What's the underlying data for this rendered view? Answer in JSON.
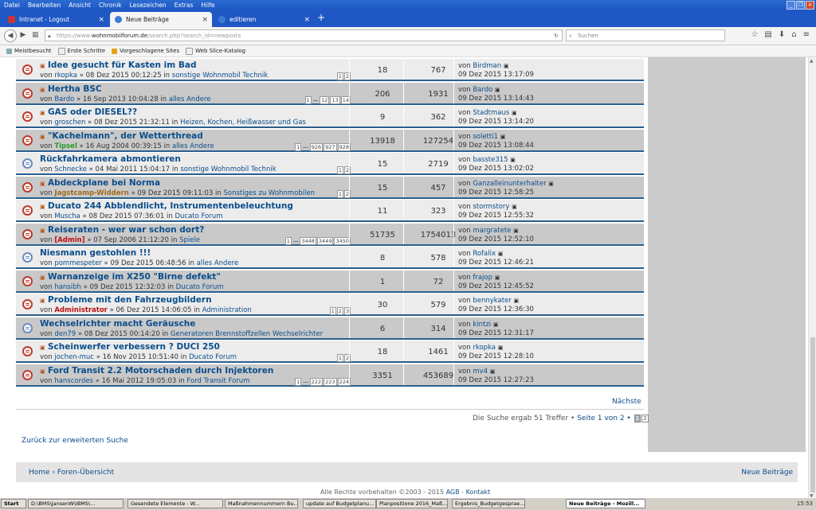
{
  "menu": [
    "Datei",
    "Bearbeiten",
    "Ansicht",
    "Chronik",
    "Lesezeichen",
    "Extras",
    "Hilfe"
  ],
  "tabs": [
    {
      "label": "Intranet - Logout",
      "active": false
    },
    {
      "label": "Neue Beiträge",
      "active": true
    },
    {
      "label": "editieren",
      "active": false
    }
  ],
  "url": {
    "prefix": "https://www.",
    "host": "wohnmobilforum.de",
    "path": "/search.php?search_id=newposts"
  },
  "search_placeholder": "Suchen",
  "bookmarks": [
    "Meistbesucht",
    "Erste Schritte",
    "Vorgeschlagene Sites",
    "Web Slice-Katalog"
  ],
  "topics": [
    {
      "title": "Idee gesucht für Kasten im Bad",
      "author": "rkopka",
      "date": "08 Dez 2015 00:12:25",
      "forum": "sonstige Wohnmobil Technik",
      "pages": [
        "1",
        "2"
      ],
      "replies": "18",
      "views": "767",
      "last_by": "Birdman",
      "last_date": "09 Dez 2015 13:17:09",
      "new": true
    },
    {
      "title": "Hertha BSC",
      "author": "Bardo",
      "date": "16 Sep 2013 10:04:28",
      "forum": "alles Andere",
      "pages": [
        "1",
        "…",
        "12",
        "13",
        "14"
      ],
      "replies": "206",
      "views": "1931",
      "last_by": "Bardo",
      "last_date": "09 Dez 2015 13:14:43",
      "new": true
    },
    {
      "title": "GAS oder DIESEL??",
      "author": "groschen",
      "date": "08 Dez 2015 21:32:11",
      "forum": "Heizen, Kochen, Heißwasser und Gas",
      "pages": [],
      "replies": "9",
      "views": "362",
      "last_by": "Stadtmaus",
      "last_date": "09 Dez 2015 13:14:20",
      "new": true
    },
    {
      "title": "\"Kachelmann\", der Wetterthread",
      "author": "Tipsel",
      "author_style": "green",
      "date": "16 Aug 2004 00:39:15",
      "forum": "alles Andere",
      "pages": [
        "1",
        "…",
        "926",
        "927",
        "928"
      ],
      "replies": "13918",
      "views": "127254",
      "last_by": "soletti1",
      "last_date": "09 Dez 2015 13:08:44",
      "new": true
    },
    {
      "title": "Rückfahrkamera abmontieren",
      "author": "Schnecke",
      "date": "04 Mai 2011 15:04:17",
      "forum": "sonstige Wohnmobil Technik",
      "pages": [
        "1",
        "2"
      ],
      "replies": "15",
      "views": "2719",
      "last_by": "basste315",
      "last_date": "09 Dez 2015 13:02:02",
      "new": false
    },
    {
      "title": "Abdeckplane bei Norma",
      "author": "Jagstcamp-Widdern",
      "author_style": "orange",
      "date": "09 Dez 2015 09:11:03",
      "forum": "Sonstiges zu Wohnmobilen",
      "pages": [
        "1",
        "2"
      ],
      "replies": "15",
      "views": "457",
      "last_by": "Ganzalleinunterhalter",
      "last_date": "09 Dez 2015 12:58:25",
      "new": true
    },
    {
      "title": "Ducato 244 Abblendlicht, Instrumentenbeleuchtung",
      "author": "Muscha",
      "date": "08 Dez 2015 07:36:01",
      "forum": "Ducato Forum",
      "pages": [],
      "replies": "11",
      "views": "323",
      "last_by": "stormstory",
      "last_date": "09 Dez 2015 12:55:32",
      "new": true
    },
    {
      "title": "Reiseraten - wer war schon dort?",
      "author": "[Admin]",
      "author_style": "red",
      "date": "07 Sep 2006 21:12:20",
      "forum": "Spiele",
      "pages": [
        "1",
        "…",
        "3448",
        "3449",
        "3450"
      ],
      "replies": "51735",
      "views": "1754013",
      "last_by": "margratete",
      "last_date": "09 Dez 2015 12:52:10",
      "new": true
    },
    {
      "title": "Niesmann gestohlen !!!",
      "author": "pommespeter",
      "date": "09 Dez 2015 06:48:56",
      "forum": "alles Andere",
      "pages": [],
      "replies": "8",
      "views": "578",
      "last_by": "Rofalix",
      "last_date": "09 Dez 2015 12:46:21",
      "new": false
    },
    {
      "title": "Warnanzeige im X250 \"Birne defekt\"",
      "author": "hansibh",
      "date": "09 Dez 2015 12:32:03",
      "forum": "Ducato Forum",
      "pages": [],
      "replies": "1",
      "views": "72",
      "last_by": "frajop",
      "last_date": "09 Dez 2015 12:45:52",
      "new": true
    },
    {
      "title": "Probleme mit den Fahrzeugbildern",
      "author": "Administrator",
      "author_style": "red",
      "date": "06 Dez 2015 14:06:05",
      "forum": "Administration",
      "pages": [
        "1",
        "2",
        "3"
      ],
      "replies": "30",
      "views": "579",
      "last_by": "bennykater",
      "last_date": "09 Dez 2015 12:36:30",
      "new": true
    },
    {
      "title": "Wechselrichter macht Geräusche",
      "author": "den79",
      "date": "08 Dez 2015 00:14:20",
      "forum": "Generatoren Brennstoffzellen Wechselrichter",
      "pages": [],
      "replies": "6",
      "views": "314",
      "last_by": "kintzi",
      "last_date": "09 Dez 2015 12:31:17",
      "new": false
    },
    {
      "title": "Scheinwerfer verbessern ? DUCI 250",
      "author": "jochen-muc",
      "date": "16 Nov 2015 10:51:40",
      "forum": "Ducato Forum",
      "pages": [
        "1",
        "2"
      ],
      "replies": "18",
      "views": "1461",
      "last_by": "rkopka",
      "last_date": "09 Dez 2015 12:28:10",
      "new": true
    },
    {
      "title": "Ford Transit 2.2 Motorschaden durch Injektoren",
      "author": "hanscordes",
      "date": "16 Mai 2012 19:05:03",
      "forum": "Ford Transit Forum",
      "pages": [
        "1",
        "…",
        "222",
        "223",
        "224"
      ],
      "replies": "3351",
      "views": "453689",
      "last_by": "mv4",
      "last_date": "09 Dez 2015 12:27:23",
      "new": true
    }
  ],
  "labels": {
    "von": "von",
    "in": "in",
    "arrow": "»"
  },
  "next": "Nächste",
  "result": {
    "text": "Die Suche ergab 51 Treffer • ",
    "page": "Seite 1 von 2 •",
    "p1": "1",
    "p2": "2"
  },
  "back": "Zurück zur erweiterten Suche",
  "footer": {
    "home": "Home ‹ Foren-Übersicht",
    "new_posts": "Neue Beiträge",
    "copy": "Alle Rechte vorbehalten ©2003 - 2015 ",
    "agb": "AGB",
    "sep": " - ",
    "kontakt": "Kontakt"
  },
  "taskbar": [
    {
      "label": "Start",
      "type": "start"
    },
    {
      "label": "D:\\BMS\\JansenW\\IBMS\\..."
    },
    {
      "label": "Gesendete Elemente - W..."
    },
    {
      "label": "Maßnahmennummern Bu..."
    },
    {
      "label": "update auf Budgetplanu..."
    },
    {
      "label": "Planpositione 2016_Maß..."
    },
    {
      "label": "Ergebnis_Budgetgesprae..."
    },
    {
      "label": "Neue Beiträge - Mozill...",
      "active": true
    }
  ],
  "clock": "15:53"
}
